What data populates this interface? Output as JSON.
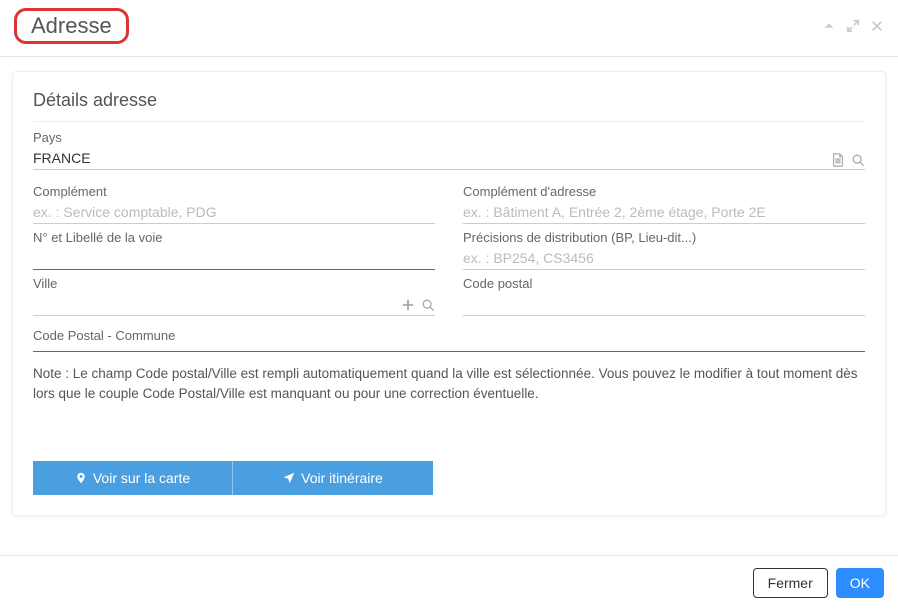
{
  "title": "Adresse",
  "panel": {
    "heading": "Détails adresse",
    "pays_label": "Pays",
    "pays_value": "FRANCE",
    "complement_label": "Complément",
    "complement_placeholder": "ex. : Service comptable, PDG",
    "complement_adresse_label": "Complément d'adresse",
    "complement_adresse_placeholder": "ex. : Bâtiment A, Entrée 2, 2ème étage, Porte 2E",
    "voie_label": "N° et Libellé de la voie",
    "precision_label": "Précisions de distribution (BP, Lieu-dit...)",
    "precision_placeholder": "ex. : BP254, CS3456",
    "ville_label": "Ville",
    "cp_label": "Code postal",
    "loc_label": "Code Postal - Commune",
    "note": "Note : Le champ Code postal/Ville est rempli automatiquement quand la ville est sélectionnée. Vous pouvez le modifier à tout moment dès lors que le couple Code Postal/Ville est manquant ou pour une correction éventuelle."
  },
  "buttons": {
    "map": "Voir sur la carte",
    "route": "Voir itinéraire",
    "close": "Fermer",
    "ok": "OK"
  }
}
